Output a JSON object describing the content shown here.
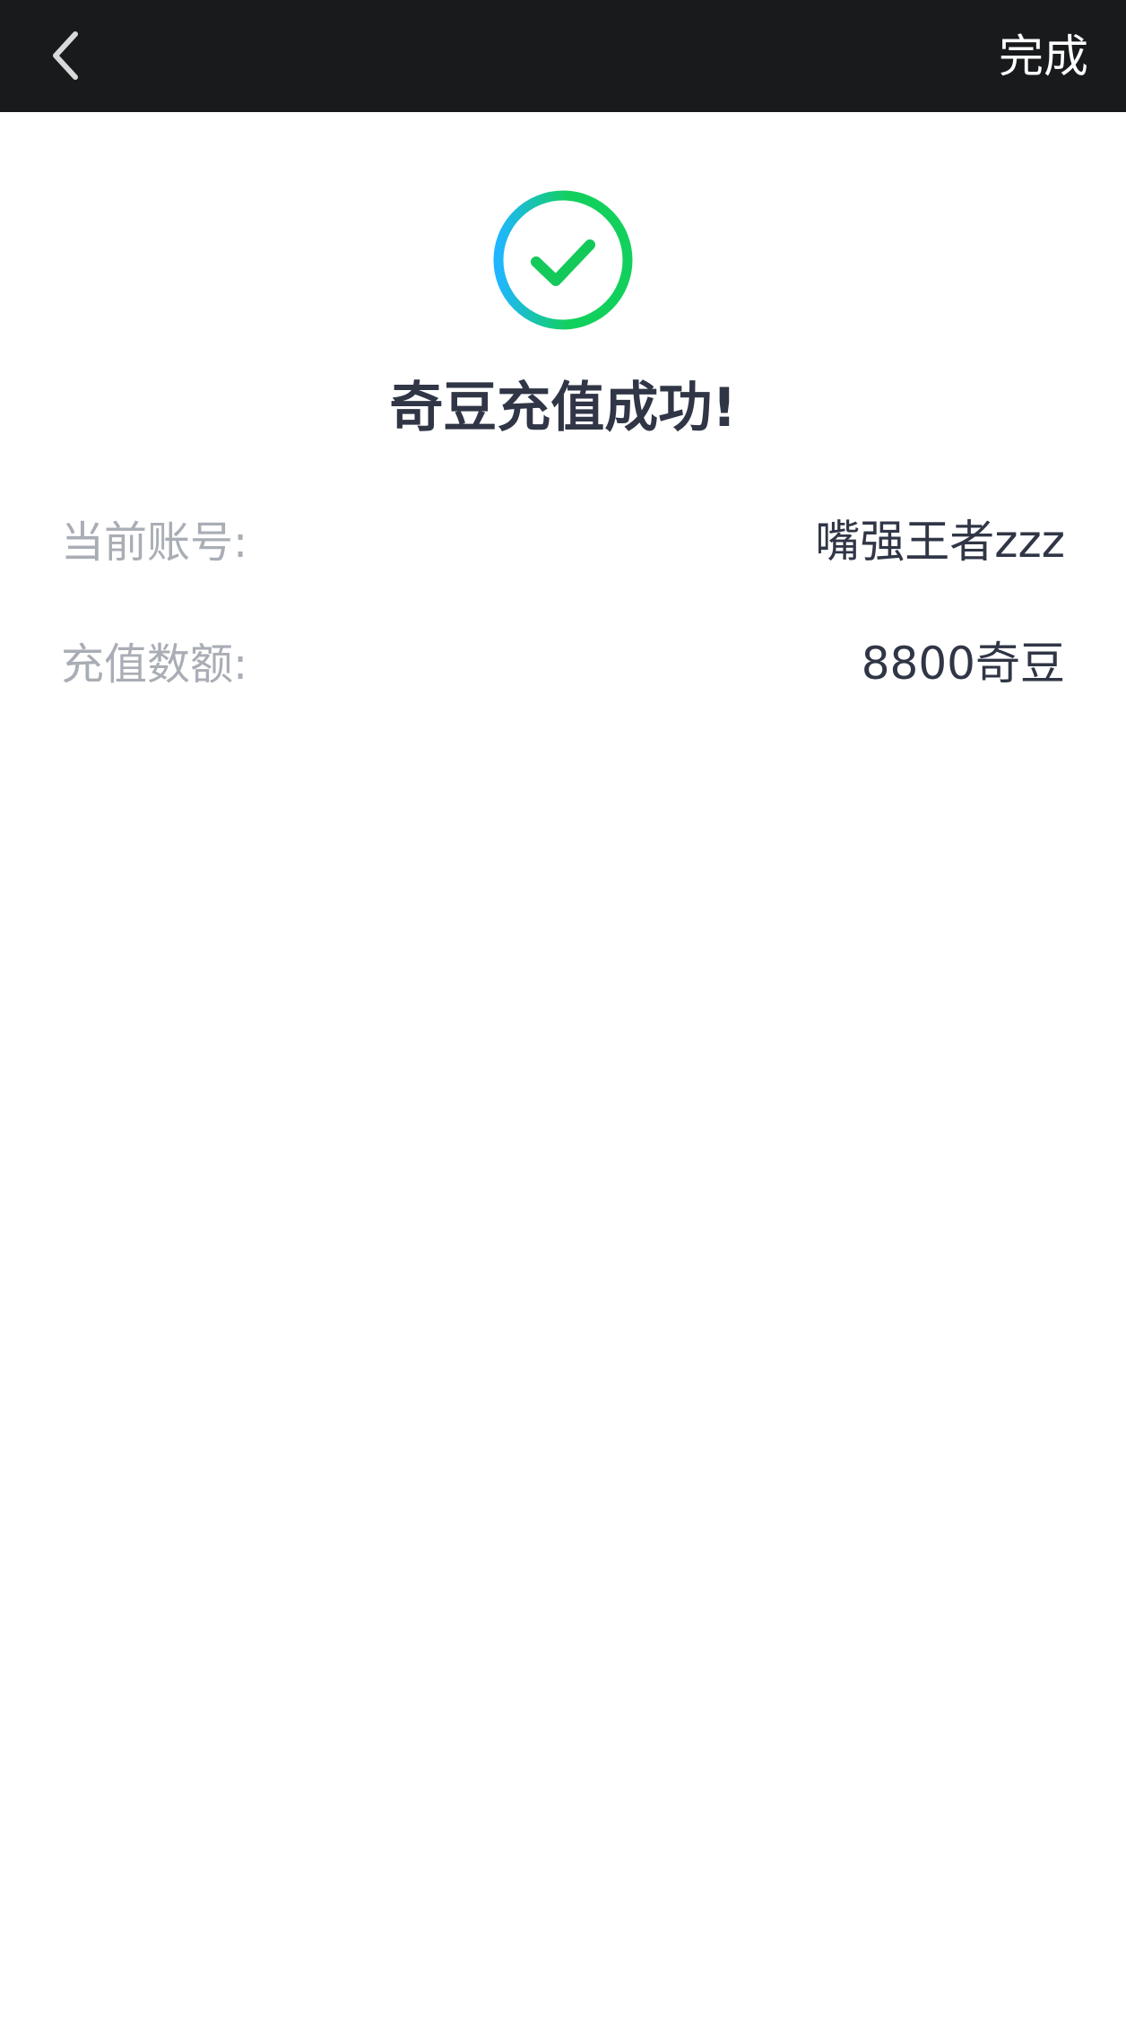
{
  "navbar": {
    "back_icon": "chevron-left-icon",
    "title": "",
    "done_label": "完成",
    "background": "#191a1c"
  },
  "result": {
    "icon": "check-circle-icon",
    "icon_colors": [
      "#1fb6ff",
      "#12d05c"
    ],
    "title": "奇豆充值成功!"
  },
  "details": {
    "account_label": "当前账号:",
    "account_value": "嘴强王者zzz",
    "amount_label": "充值数额:",
    "amount_value": "8800奇豆"
  }
}
